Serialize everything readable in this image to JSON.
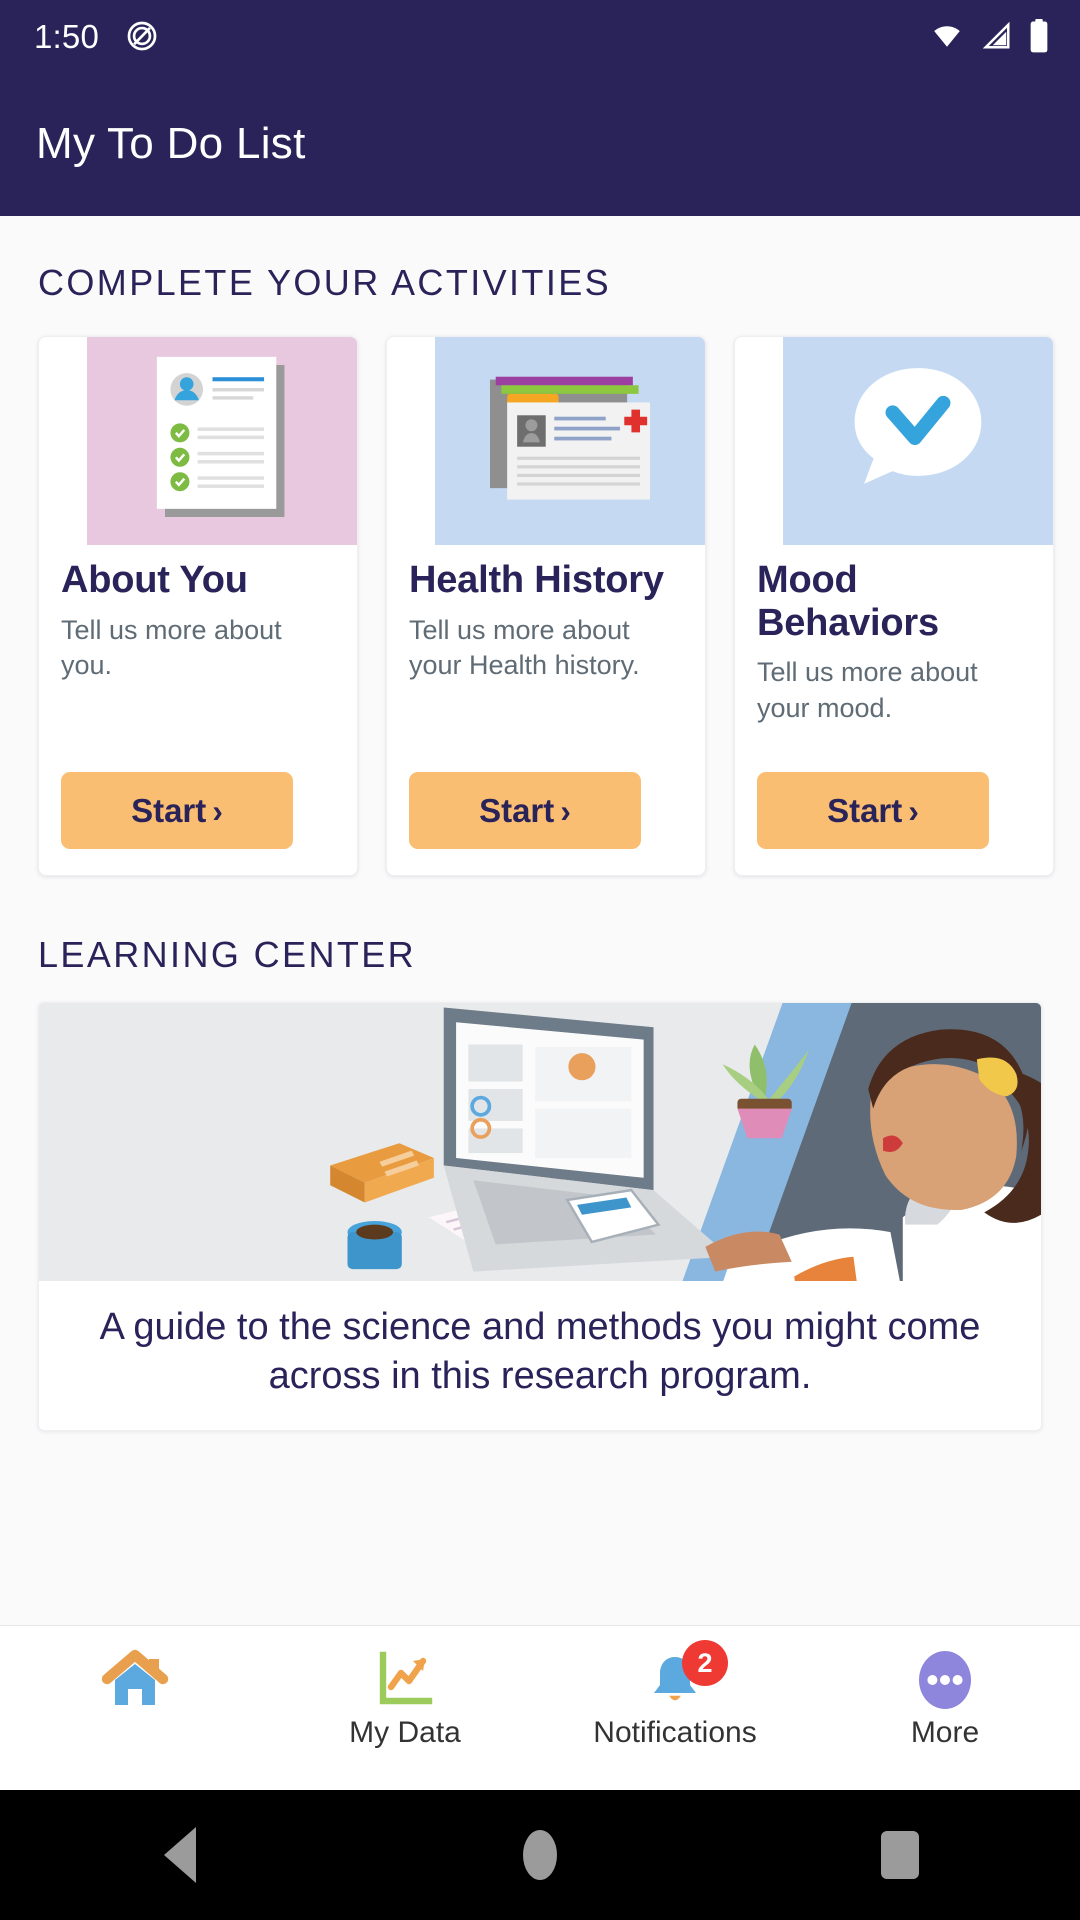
{
  "status_bar": {
    "time": "1:50",
    "icons": [
      "do-not-disturb-icon",
      "wifi-icon",
      "cell-signal-icon",
      "battery-icon"
    ]
  },
  "app_bar": {
    "title": "My To Do List"
  },
  "activities": {
    "section_title": "COMPLETE YOUR ACTIVITIES",
    "cards": [
      {
        "title": "About You",
        "subtitle": "Tell us more about you.",
        "button": "Start",
        "image_bg": "#E7C8DE",
        "image_name": "about-you-illustration"
      },
      {
        "title": "Health History",
        "subtitle": "Tell us more about your Health history.",
        "button": "Start",
        "image_bg": "#C5DAF2",
        "image_name": "health-history-illustration"
      },
      {
        "title": "Mood Behaviors",
        "subtitle": "Tell us more about your mood.",
        "button": "Start",
        "image_bg": "#C5DAF2",
        "image_name": "mood-behaviors-illustration"
      }
    ]
  },
  "learning_center": {
    "section_title": "LEARNING CENTER",
    "image_name": "learning-center-illustration",
    "caption": "A guide to the science and methods you might come across in this research program."
  },
  "bottom_nav": {
    "items": [
      {
        "label": "",
        "icon": "home-icon",
        "badge": ""
      },
      {
        "label": "My Data",
        "icon": "chart-icon",
        "badge": ""
      },
      {
        "label": "Notifications",
        "icon": "bell-icon",
        "badge": "2"
      },
      {
        "label": "More",
        "icon": "more-dots-icon",
        "badge": ""
      }
    ]
  },
  "android_nav": {
    "back": "back-button",
    "home": "home-button",
    "recents": "recents-button"
  },
  "colors": {
    "brand_navy": "#2A2359",
    "accent_orange": "#F9BE72",
    "badge_red": "#EF3A33",
    "page_bg": "#FAFAFB"
  }
}
